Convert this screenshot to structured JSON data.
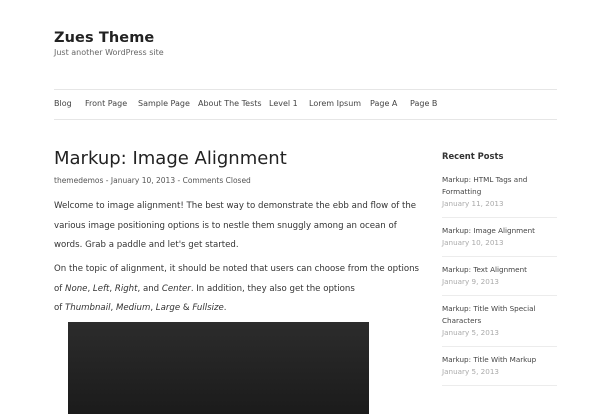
{
  "site": {
    "title": "Zues Theme",
    "tagline": "Just another WordPress site"
  },
  "nav": {
    "items": [
      "Blog",
      "Front Page",
      "Sample Page",
      "About The Tests",
      "Level 1",
      "Lorem Ipsum",
      "Page A",
      "Page B"
    ]
  },
  "post": {
    "title": "Markup: Image Alignment",
    "author": "themedemos",
    "sep1": " - ",
    "date": "January 10, 2013",
    "sep2": " - ",
    "comments": "Comments Closed",
    "p1": {
      "line1": "Welcome to image alignment! The best way to demonstrate the ebb and flow of the",
      "line2": "various image positioning options is to nestle them snuggly among an ocean of",
      "line3": "words. Grab a paddle and let's get started."
    },
    "p2": {
      "line1": "On the topic of alignment, it should be noted that users can choose from the options",
      "l2_a": "of ",
      "l2_none": "None",
      "l2_b": ", ",
      "l2_left": "Left",
      "l2_c": ", ",
      "l2_right": "Right",
      "l2_d": ", and ",
      "l2_center": "Center",
      "l2_e": ". In addition, they also get the options",
      "l3_a": "of ",
      "l3_thumb": "Thumbnail",
      "l3_b": ", ",
      "l3_medium": "Medium",
      "l3_c": ", ",
      "l3_large": "Large",
      "l3_d": " & ",
      "l3_full": "Fullsize",
      "l3_e": "."
    }
  },
  "sidebar": {
    "title": "Recent Posts",
    "posts": [
      {
        "line1": "Markup: HTML Tags and",
        "line2": "Formatting",
        "date": "January 11, 2013"
      },
      {
        "line1": "Markup: Image Alignment",
        "line2": "",
        "date": "January 10, 2013"
      },
      {
        "line1": "Markup: Text Alignment",
        "line2": "",
        "date": "January 9, 2013"
      },
      {
        "line1": "Markup: Title With Special",
        "line2": "Characters",
        "date": "January 5, 2013"
      },
      {
        "line1": "Markup: Title With Markup",
        "line2": "",
        "date": "January 5, 2013"
      }
    ]
  },
  "colors": {
    "text": "#333333",
    "muted_date": "#aaaaaa",
    "border": "#e6e6e6",
    "image_dark": "#222222"
  }
}
